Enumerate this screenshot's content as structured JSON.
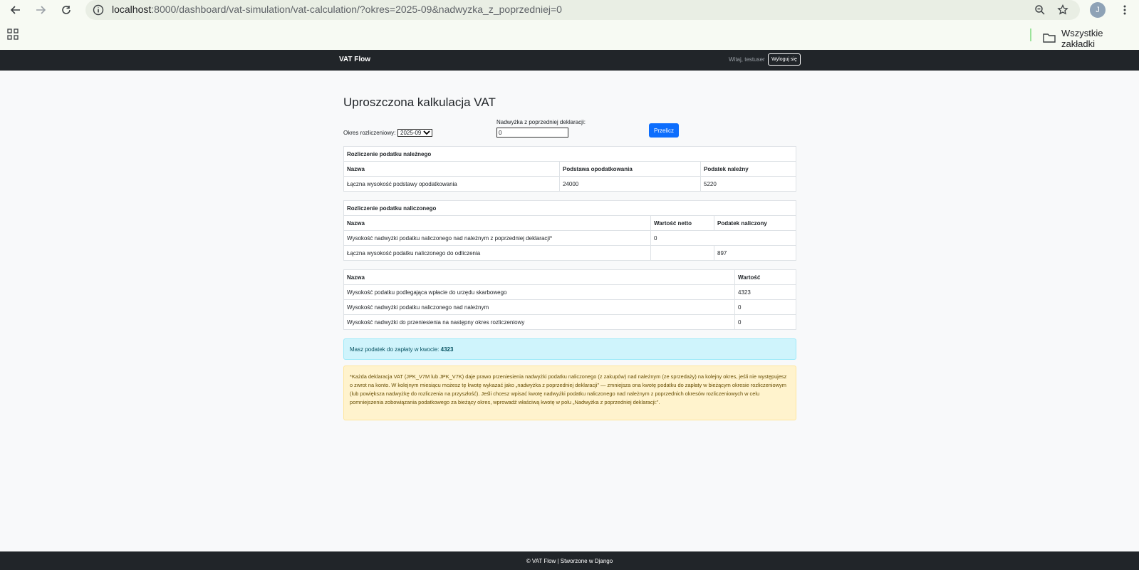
{
  "browser": {
    "url_host": "localhost",
    "url_rest": ":8000/dashboard/vat-simulation/vat-calculation/?okres=2025-09&nadwyzka_z_poprzedniej=0",
    "profile_initial": "J",
    "bookmarks_all": "Wszystkie zakładki"
  },
  "navbar": {
    "brand": "VAT Flow",
    "welcome": "Witaj, testuser",
    "logout": "Wyloguj się"
  },
  "page": {
    "title": "Uproszczona kalkulacja VAT"
  },
  "form": {
    "period_label": "Okres rozliczeniowy:",
    "period_value": "2025-09",
    "surplus_label": "Nadwyżka z poprzedniej deklaracji:",
    "surplus_value": "0",
    "recalc_button": "Przelicz"
  },
  "table_due": {
    "caption": "Rozliczenie podatku należnego",
    "headers": [
      "Nazwa",
      "Podstawa opodatkowania",
      "Podatek należny"
    ],
    "rows": [
      [
        "Łączna wysokość podstawy opodatkowania",
        "24000",
        "5220"
      ]
    ]
  },
  "table_input": {
    "caption": "Rozliczenie podatku naliczonego",
    "headers": [
      "Nazwa",
      "Wartość netto",
      "Podatek naliczony"
    ],
    "rows": [
      [
        "Wysokość nadwyżki podatku naliczonego nad należnym z poprzedniej deklaracji*",
        "0",
        ""
      ],
      [
        "Łączna wysokość podatku naliczonego do odliczenia",
        "",
        "897"
      ]
    ]
  },
  "table_summary": {
    "headers": [
      "Nazwa",
      "Wartość"
    ],
    "rows": [
      [
        "Wysokość podatku podlegająca wpłacie do urzędu skarbowego",
        "4323"
      ],
      [
        "Wysokość nadwyżki podatku naliczonego nad należnym",
        "0"
      ],
      [
        "Wysokość nadwyżki do przeniesienia na następny okres rozliczeniowy",
        "0"
      ]
    ]
  },
  "alert_info": {
    "text": "Masz podatek do zapłaty w kwocie: ",
    "amount": "4323"
  },
  "alert_warning": {
    "text": "*Każda deklaracja VAT (JPK_V7M lub JPK_V7K) daje prawo przeniesienia nadwyżki podatku naliczonego (z zakupów) nad należnym (ze sprzedaży) na kolejny okres, jeśli nie występujesz o zwrot na konto. W kolejnym miesiącu możesz tę kwotę wykazać jako „nadwyżka z poprzedniej deklaracji” — zmniejsza ona kwotę podatku do zapłaty w bieżącym okresie rozliczeniowym (lub powiększa nadwyżkę do rozliczenia na przyszłość). Jeśli chcesz wpisać kwotę nadwyżki podatku naliczonego nad należnym z poprzednich okresów rozliczeniowych w celu pomniejszenia zobowiązania podatkowego za bieżący okres, wprowadź właściwą kwotę w polu „Nadwyżka z poprzedniej deklaracji:”."
  },
  "footer": {
    "text": "© VAT Flow | Stworzone w Django"
  }
}
